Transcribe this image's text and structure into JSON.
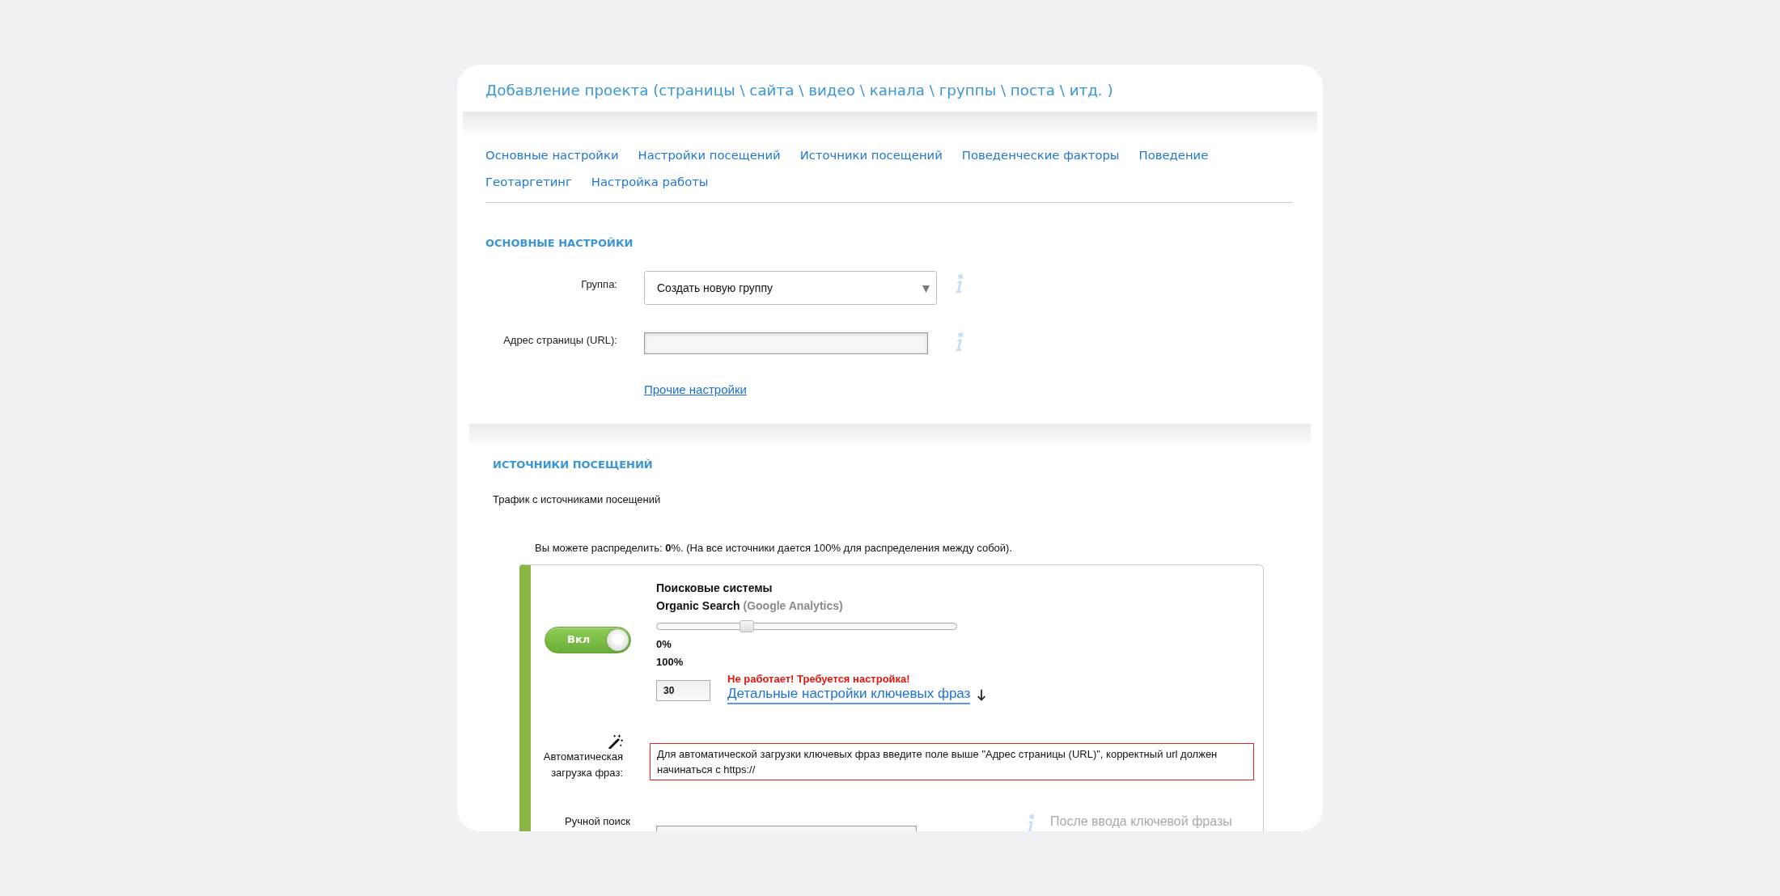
{
  "page_title": "Добавление проекта (страницы \\ сайта \\ видео \\ канала \\ группы \\ поста \\ итд. )",
  "nav_links": [
    "Основные настройки",
    "Настройки посещений",
    "Источники посещений",
    "Поведенческие факторы",
    "Поведение",
    "Геотаргетинг",
    "Настройка работы"
  ],
  "basic_settings": {
    "heading": "ОСНОВНЫЕ НАСТРОЙКИ",
    "fields": [
      {
        "kind": "select",
        "label": "Группа:",
        "value": "Создать новую группу"
      },
      {
        "kind": "text",
        "label": "Адрес страницы (URL):"
      }
    ],
    "more_link": "Прочие настройки"
  },
  "traffic_sources": {
    "heading": "ИСТОЧНИКИ ПОСЕЩЕНИЙ",
    "subtitle": "Трафик с источниками посещений",
    "distribution_note": "Вы можете распределить: **0**%. (На все источники дается 100% для распределения между собой).",
    "sources": [
      {
        "on": true,
        "toggle_label": "Вкл",
        "title": "Поисковые системы",
        "name": "Organic Search",
        "name_note": "(Google Analytics)",
        "level": 0.3,
        "min_label": "0%",
        "max_label": "100%",
        "value": "30",
        "warning": "Не работает! Требуется настройка!",
        "details_link": "Детальные настройки ключевых фраз",
        "auto_load": {
          "label": "Автоматическая загрузка фраз:",
          "message": "Для автоматической загрузки ключевых фраз введите поле выше \"Адрес страницы (URL)\", корректный url должен начинаться с https://"
        },
        "manual_search": {
          "label": "Ручной поиск",
          "hint": "После ввода ключевой фразы"
        }
      }
    ]
  }
}
